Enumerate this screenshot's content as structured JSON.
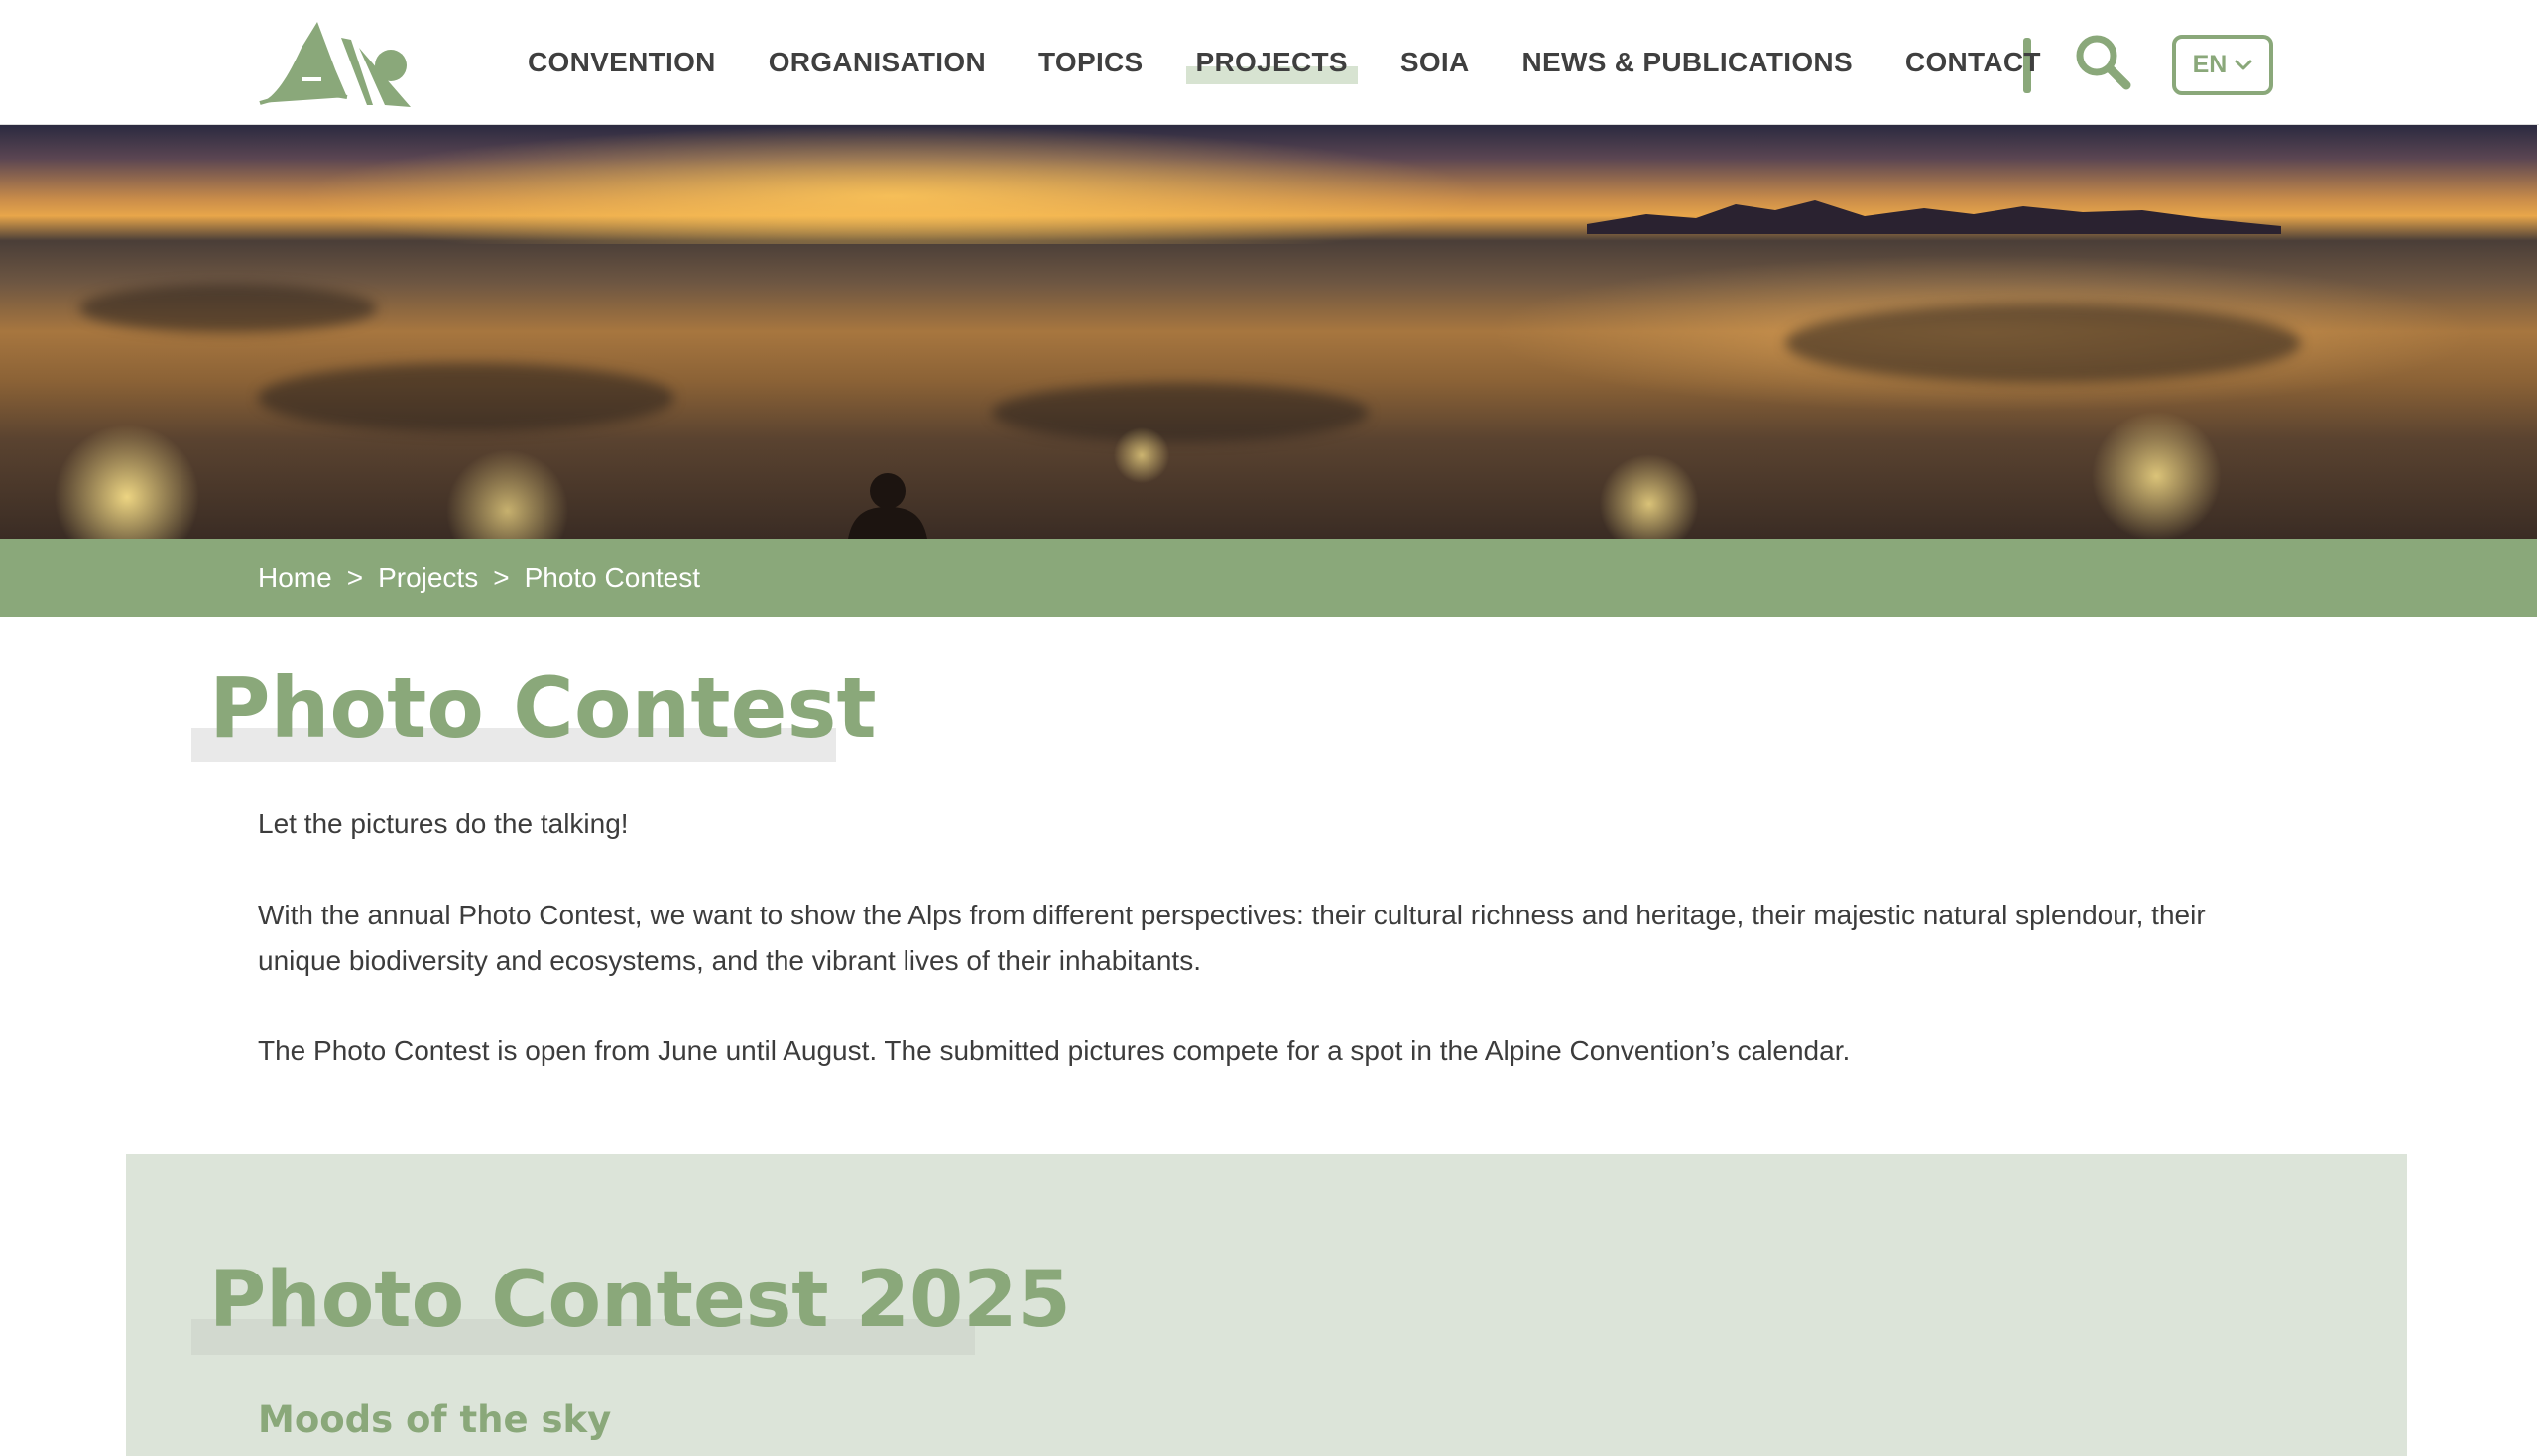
{
  "header": {
    "logo_name": "alpine-convention-logo",
    "nav": [
      {
        "label": "CONVENTION",
        "active": false
      },
      {
        "label": "ORGANISATION",
        "active": false
      },
      {
        "label": "TOPICS",
        "active": false
      },
      {
        "label": "PROJECTS",
        "active": true
      },
      {
        "label": "SOIA",
        "active": false
      },
      {
        "label": "NEWS & PUBLICATIONS",
        "active": false
      },
      {
        "label": "CONTACT",
        "active": false
      }
    ],
    "search_icon": "search-icon",
    "language": {
      "selected": "EN",
      "icon": "chevron-down-icon"
    }
  },
  "hero": {
    "image": "alpine-night-panorama"
  },
  "breadcrumb": {
    "home": "Home",
    "projects": "Projects",
    "current": "Photo Contest",
    "separator": ">"
  },
  "main": {
    "title": "Photo Contest",
    "intro": "Let the pictures do the talking!",
    "paragraph_1": "With the annual Photo Contest, we want to show the Alps from different perspectives: their cultural richness and heritage, their majestic natural splendour, their unique biodiversity and ecosystems, and the vibrant lives of their inhabitants.",
    "paragraph_2": "The Photo Contest is open from June until August. The submitted pictures compete for a spot in the Alpine Convention’s calendar."
  },
  "section": {
    "title": "Photo Contest 2025",
    "subtitle": "Moods of the sky"
  },
  "colors": {
    "accent_green": "#8aa87a",
    "section_bg": "#dce4d9",
    "nav_active_highlight": "#d7e3d1",
    "text": "#3c3c3c"
  }
}
